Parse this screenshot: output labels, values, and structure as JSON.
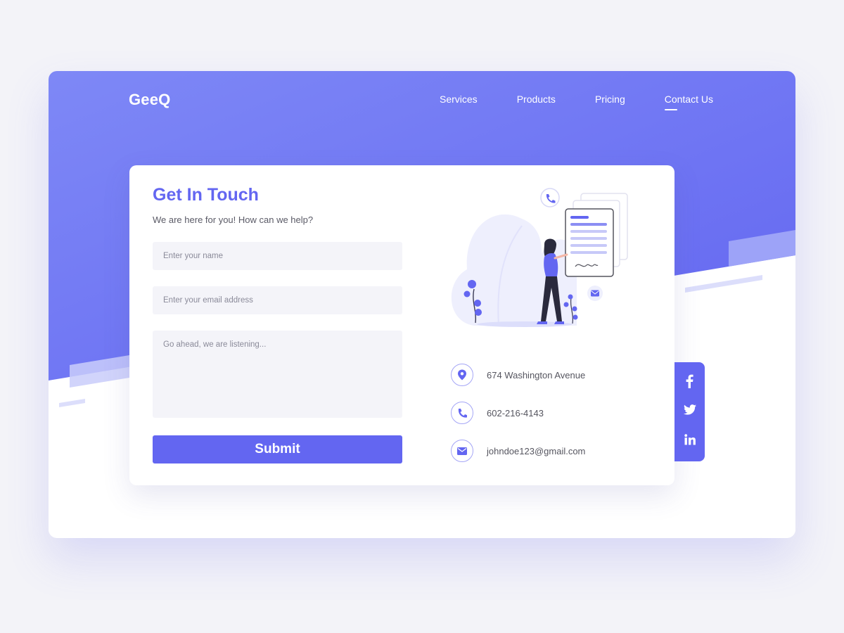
{
  "nav": {
    "logo": "GeeQ",
    "links": [
      "Services",
      "Products",
      "Pricing",
      "Contact Us"
    ],
    "active": "Contact Us"
  },
  "contact_form": {
    "title": "Get In Touch",
    "subtitle": "We are here for you! How can we help?",
    "name_placeholder": "Enter your name",
    "email_placeholder": "Enter your email address",
    "message_placeholder": "Go ahead, we are listening...",
    "submit_label": "Submit"
  },
  "contact_info": {
    "address": "674 Washington Avenue",
    "phone": "602-216-4143",
    "email": "johndoe123@gmail.com"
  },
  "social": {
    "icons": [
      "facebook-icon",
      "twitter-icon",
      "linkedin-icon"
    ]
  },
  "colors": {
    "accent": "#6366f1",
    "page_bg": "#f3f3f8",
    "field_bg": "#f4f4f9"
  }
}
